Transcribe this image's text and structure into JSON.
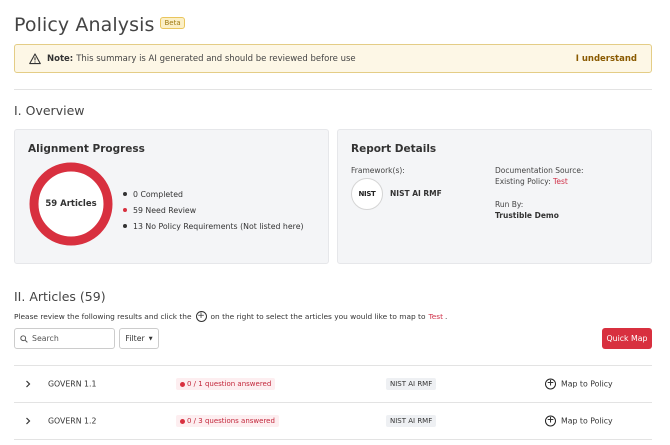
{
  "header": {
    "title": "Policy Analysis",
    "badge": "Beta"
  },
  "note": {
    "label": "Note:",
    "text": "This summary is AI generated and should be reviewed before use",
    "ack": "I understand"
  },
  "overview": {
    "title": "I. Overview",
    "alignment": {
      "title": "Alignment Progress",
      "donut_label": "59 Articles",
      "progress_completed_fraction": 0,
      "legend": [
        {
          "text": "0 Completed",
          "color": "#333333"
        },
        {
          "text": "59 Need Review",
          "color": "#d8303f"
        },
        {
          "text": "13 No Policy Requirements (Not listed here)",
          "color": "#333333"
        }
      ],
      "ring_color": "#d8303f"
    },
    "report": {
      "title": "Report Details",
      "framework_label": "Framework(s):",
      "framework_logo_text": "NIST",
      "framework_name": "NIST AI RMF",
      "doc_source_label": "Documentation Source:",
      "existing_policy_label": "Existing Policy:",
      "existing_policy_value": "Test",
      "run_by_label": "Run By:",
      "run_by_value": "Trustible Demo"
    }
  },
  "articles": {
    "title": "II. Articles (59)",
    "instructions_before": "Please review the following results and click the",
    "instructions_after": "on the right to select the articles you would like to map to",
    "instructions_target": "Test",
    "instructions_end": ".",
    "search_placeholder": "Search",
    "filter_label": "Filter",
    "quick_map_label": "Quick Map",
    "rows": [
      {
        "name": "GOVERN 1.1",
        "status": "0 / 1 question answered",
        "framework": "NIST AI RMF",
        "action": "Map to Policy"
      },
      {
        "name": "GOVERN 1.2",
        "status": "0 / 3 questions answered",
        "framework": "NIST AI RMF",
        "action": "Map to Policy"
      }
    ]
  },
  "colors": {
    "accent": "#d8303f",
    "warning_bg": "#fdf7e6",
    "warning_border": "#e4cd86"
  }
}
